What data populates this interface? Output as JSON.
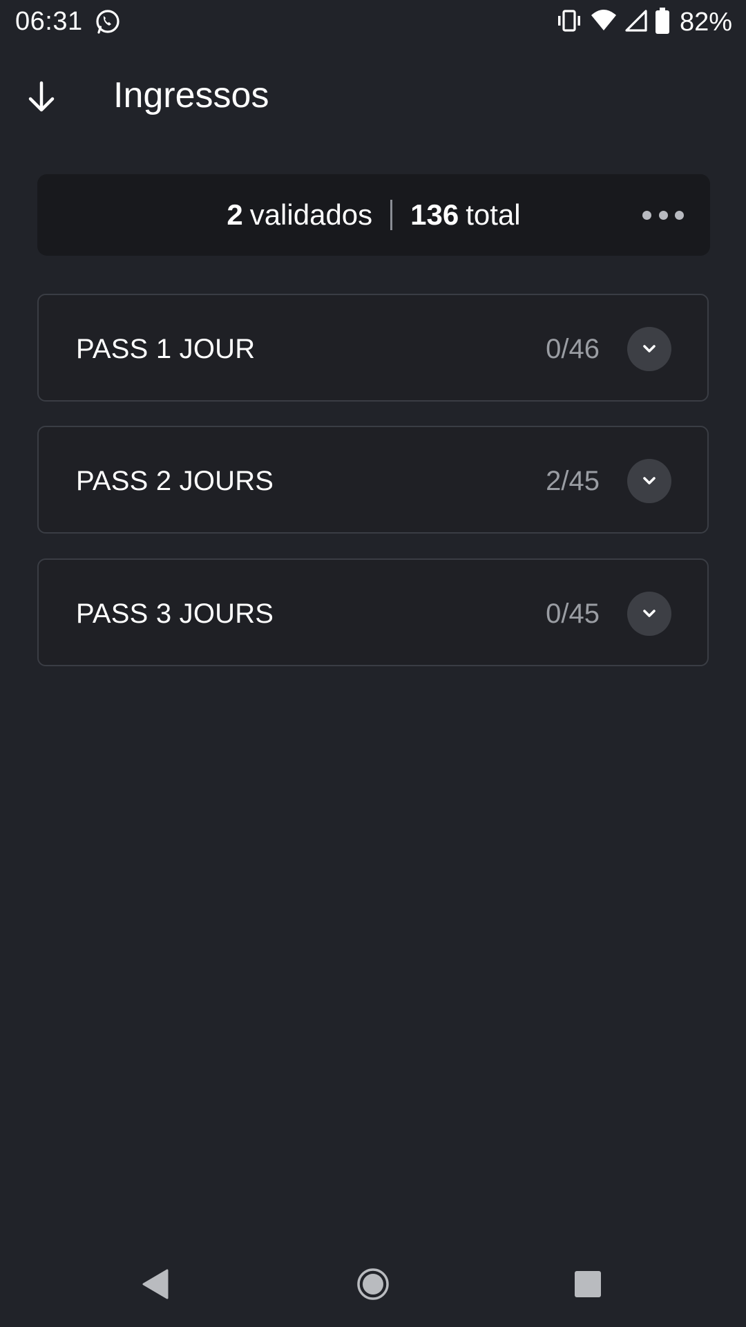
{
  "status_bar": {
    "time": "06:31",
    "battery": "82%",
    "icons": [
      "whatsapp-icon",
      "vibrate-icon",
      "wifi-icon",
      "signal-icon",
      "battery-icon"
    ]
  },
  "app_bar": {
    "title": "Ingressos",
    "back_icon": "arrow-down-icon"
  },
  "summary": {
    "validated_count": "2",
    "validated_label": "validados",
    "total_count": "136",
    "total_label": "total",
    "more_icon": "more-horizontal-icon"
  },
  "passes": [
    {
      "name": "PASS 1 JOUR",
      "count": "0/46"
    },
    {
      "name": "PASS 2 JOURS",
      "count": "2/45"
    },
    {
      "name": "PASS 3 JOURS",
      "count": "0/45"
    }
  ],
  "nav_bar": {
    "icons": [
      "nav-back-icon",
      "nav-home-icon",
      "nav-recents-icon"
    ]
  },
  "colors": {
    "background": "#212329",
    "card": "#18191d",
    "border": "#3a3d44",
    "muted_text": "#9a9da3",
    "button_circle": "#3d3f45"
  }
}
